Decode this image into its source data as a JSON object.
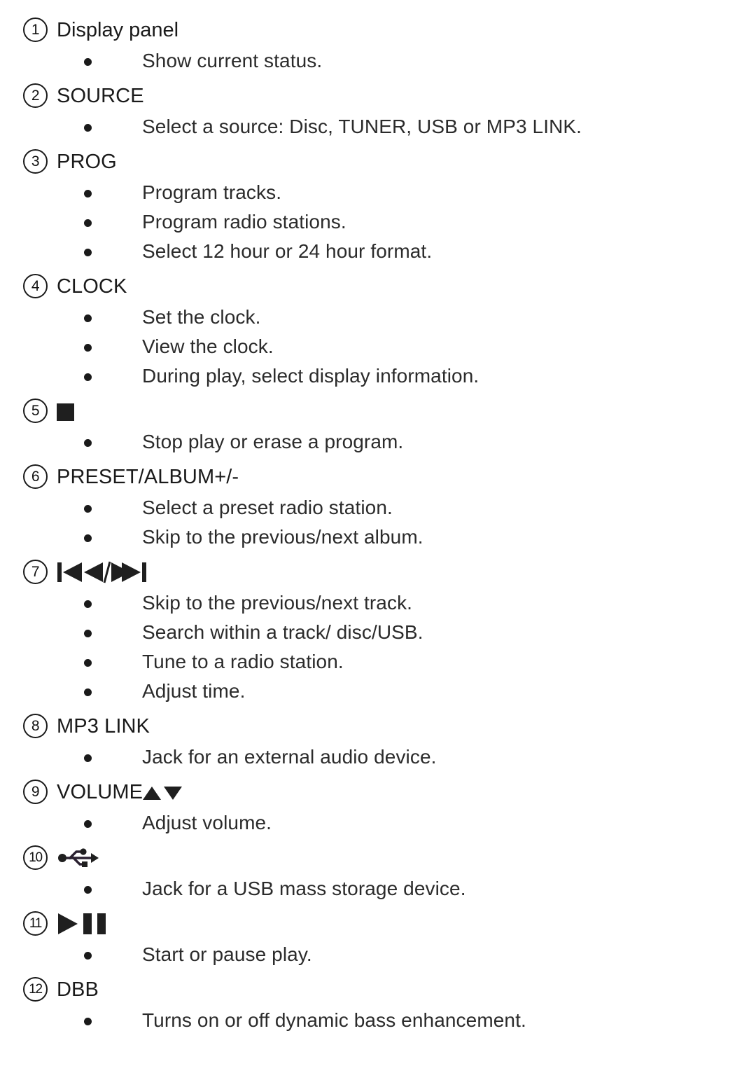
{
  "document": {
    "type": "control-reference-list",
    "text_color": "#1a1a1a",
    "background_color": "#ffffff"
  },
  "items": [
    {
      "number": "1",
      "heading": "Display panel",
      "heading_style": "mixed",
      "icon": null,
      "bullets": [
        "Show current status."
      ]
    },
    {
      "number": "2",
      "heading": "SOURCE",
      "heading_style": "caps",
      "icon": null,
      "bullets": [
        "Select a source: Disc, TUNER, USB or MP3 LINK."
      ]
    },
    {
      "number": "3",
      "heading": "PROG",
      "heading_style": "caps",
      "icon": null,
      "bullets": [
        "Program tracks.",
        "Program radio stations.",
        "Select 12 hour or 24 hour format."
      ]
    },
    {
      "number": "4",
      "heading": "CLOCK",
      "heading_style": "caps",
      "icon": null,
      "bullets": [
        "Set the clock.",
        "View the clock.",
        "During play, select display information."
      ]
    },
    {
      "number": "5",
      "heading": "",
      "heading_style": "icon",
      "icon": "stop-icon",
      "bullets": [
        "Stop play or erase a program."
      ]
    },
    {
      "number": "6",
      "heading": "PRESET/ALBUM+/-",
      "heading_style": "caps",
      "icon": null,
      "bullets": [
        "Select a preset radio station.",
        "Skip to the previous/next album."
      ]
    },
    {
      "number": "7",
      "heading": "",
      "heading_style": "icon",
      "icon": "skip-previous-next-icon",
      "bullets": [
        "Skip to the previous/next track.",
        "Search within a track/ disc/USB.",
        "Tune to a radio station.",
        "Adjust time."
      ]
    },
    {
      "number": "8",
      "heading": "MP3 LINK",
      "heading_style": "caps",
      "icon": null,
      "bullets": [
        "Jack for an external audio device."
      ]
    },
    {
      "number": "9",
      "heading": "VOLUME",
      "heading_style": "caps-with-arrows",
      "icon": "volume-up-down-arrows-icon",
      "bullets": [
        "Adjust volume."
      ]
    },
    {
      "number": "10",
      "heading": "",
      "heading_style": "icon",
      "icon": "usb-icon",
      "bullets": [
        "Jack for a USB mass storage device."
      ]
    },
    {
      "number": "11",
      "heading": "",
      "heading_style": "icon",
      "icon": "play-pause-icon",
      "bullets": [
        "Start or pause play."
      ]
    },
    {
      "number": "12",
      "heading": "DBB",
      "heading_style": "caps",
      "icon": null,
      "bullets": [
        "Turns on or off dynamic bass enhancement."
      ]
    }
  ]
}
